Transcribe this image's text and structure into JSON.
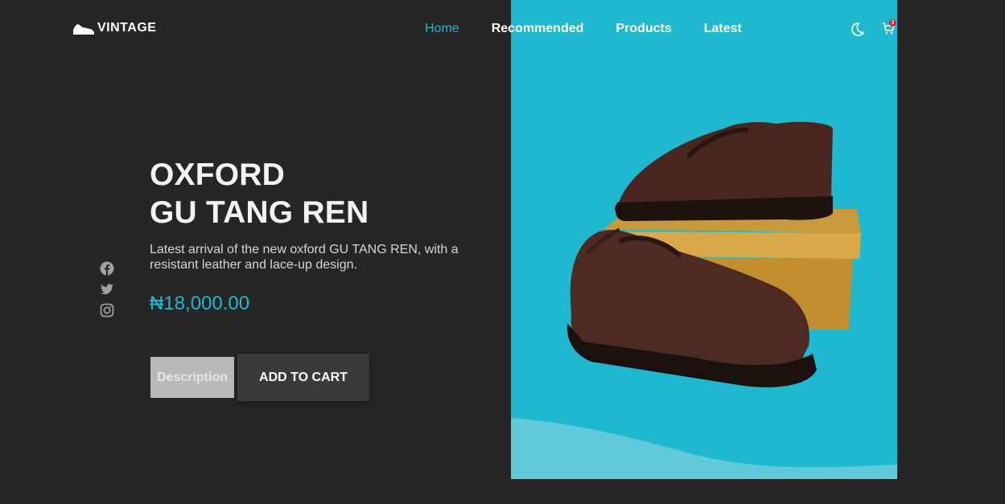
{
  "brand": {
    "name": "VINTAGE",
    "logo_icon": "sneaker-icon"
  },
  "nav": {
    "items": [
      {
        "label": "Home",
        "active": true
      },
      {
        "label": "Recommended",
        "active": false
      },
      {
        "label": "Products",
        "active": false
      },
      {
        "label": "Latest",
        "active": false
      }
    ]
  },
  "header_icons": {
    "theme": "moon-icon",
    "cart": "cart-icon",
    "cart_count": "3"
  },
  "social": [
    "facebook-icon",
    "twitter-icon",
    "instagram-icon"
  ],
  "hero": {
    "title_line1": "OXFORD",
    "title_line2": "GU TANG REN",
    "description": "Latest arrival of the new oxford GU TANG REN, with a resistant leather and lace-up design.",
    "price": "₦18,000.00",
    "description_button": "Description",
    "cart_button": "ADD TO CART"
  },
  "colors": {
    "accent": "#1eb9cf",
    "background": "#262626",
    "button_dark": "#3a3a3a",
    "button_light": "#b8b8b8"
  }
}
